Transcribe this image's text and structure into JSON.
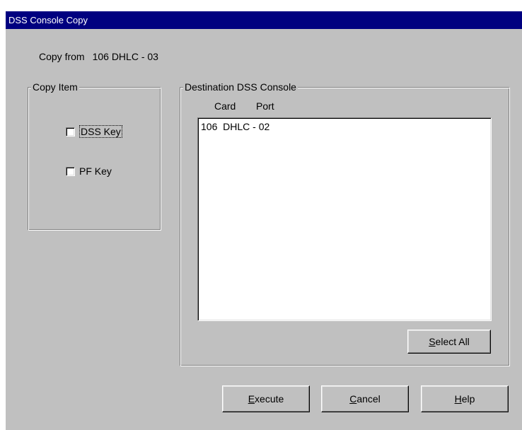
{
  "window": {
    "title": "DSS Console Copy"
  },
  "copy_from": {
    "label": "Copy from",
    "value": "106 DHLC - 03"
  },
  "copy_item": {
    "legend": "Copy Item",
    "options": [
      {
        "label": "DSS Key",
        "checked": false
      },
      {
        "label": "PF Key",
        "checked": false
      }
    ]
  },
  "destination": {
    "legend": "Destination DSS Console",
    "columns": [
      "Card",
      "Port"
    ],
    "items": [
      "106  DHLC - 02"
    ],
    "select_all": {
      "mnemonic": "S",
      "rest": "elect All"
    }
  },
  "buttons": {
    "execute": {
      "mnemonic": "E",
      "rest": "xecute"
    },
    "cancel": {
      "mnemonic": "C",
      "rest": "ancel"
    },
    "help": {
      "mnemonic": "H",
      "rest": "elp"
    }
  }
}
